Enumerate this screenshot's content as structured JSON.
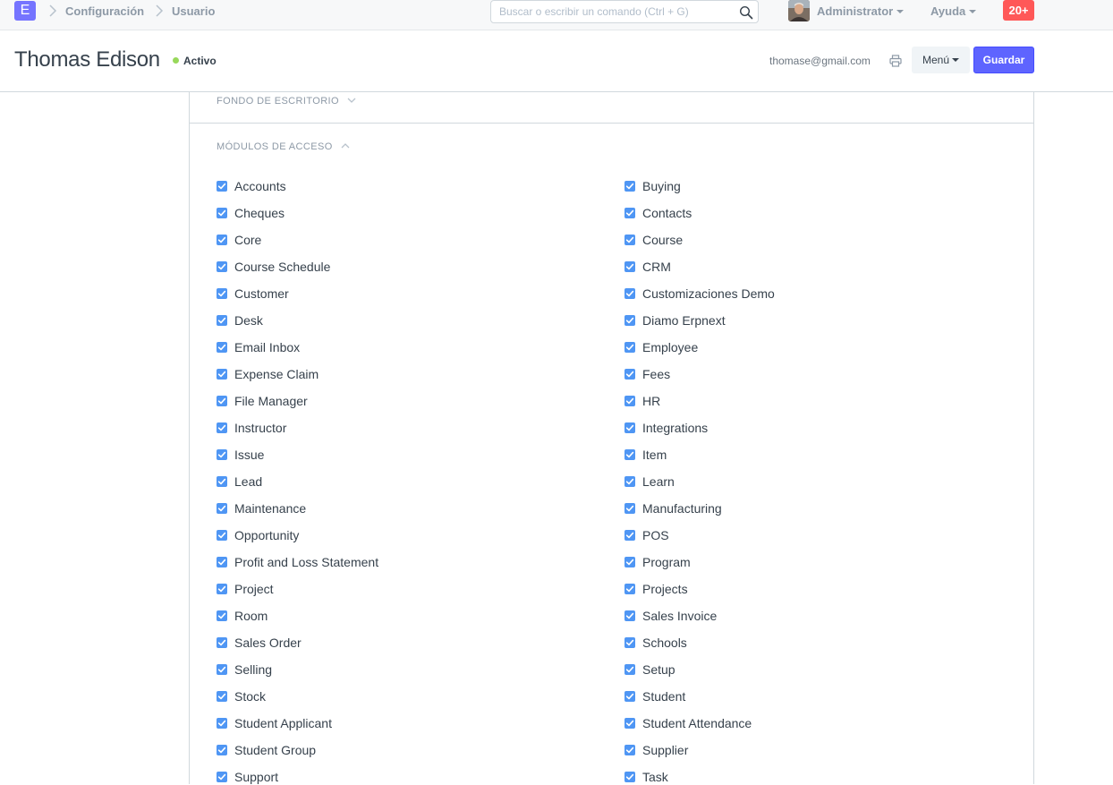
{
  "navbar": {
    "logo_letter": "E",
    "breadcrumbs": [
      "Configuración",
      "Usuario"
    ],
    "search_placeholder": "Buscar o escribir un comando (Ctrl + G)",
    "search_icon": "search-icon",
    "user_name": "Administrator",
    "help_label": "Ayuda",
    "notifications_badge": "20+"
  },
  "page_head": {
    "title": "Thomas Edison",
    "status": "Activo",
    "status_color": "#98d85b",
    "email": "thomase@gmail.com",
    "print_icon": "print-icon",
    "menu_label": "Menú",
    "save_label": "Guardar",
    "save_color": "#5e64ff"
  },
  "sections": {
    "desktop_background": {
      "title": "FONDO DE ESCRITORIO",
      "collapsed": true
    },
    "access_modules": {
      "title": "MÓDULOS DE ACCESO",
      "collapsed": false
    }
  },
  "modules": [
    {
      "label": "Accounts",
      "checked": true
    },
    {
      "label": "Buying",
      "checked": true
    },
    {
      "label": "Cheques",
      "checked": true
    },
    {
      "label": "Contacts",
      "checked": true
    },
    {
      "label": "Core",
      "checked": true
    },
    {
      "label": "Course",
      "checked": true
    },
    {
      "label": "Course Schedule",
      "checked": true
    },
    {
      "label": "CRM",
      "checked": true
    },
    {
      "label": "Customer",
      "checked": true
    },
    {
      "label": "Customizaciones Demo",
      "checked": true
    },
    {
      "label": "Desk",
      "checked": true
    },
    {
      "label": "Diamo Erpnext",
      "checked": true
    },
    {
      "label": "Email Inbox",
      "checked": true
    },
    {
      "label": "Employee",
      "checked": true
    },
    {
      "label": "Expense Claim",
      "checked": true
    },
    {
      "label": "Fees",
      "checked": true
    },
    {
      "label": "File Manager",
      "checked": true
    },
    {
      "label": "HR",
      "checked": true
    },
    {
      "label": "Instructor",
      "checked": true
    },
    {
      "label": "Integrations",
      "checked": true
    },
    {
      "label": "Issue",
      "checked": true
    },
    {
      "label": "Item",
      "checked": true
    },
    {
      "label": "Lead",
      "checked": true
    },
    {
      "label": "Learn",
      "checked": true
    },
    {
      "label": "Maintenance",
      "checked": true
    },
    {
      "label": "Manufacturing",
      "checked": true
    },
    {
      "label": "Opportunity",
      "checked": true
    },
    {
      "label": "POS",
      "checked": true
    },
    {
      "label": "Profit and Loss Statement",
      "checked": true
    },
    {
      "label": "Program",
      "checked": true
    },
    {
      "label": "Project",
      "checked": true
    },
    {
      "label": "Projects",
      "checked": true
    },
    {
      "label": "Room",
      "checked": true
    },
    {
      "label": "Sales Invoice",
      "checked": true
    },
    {
      "label": "Sales Order",
      "checked": true
    },
    {
      "label": "Schools",
      "checked": true
    },
    {
      "label": "Selling",
      "checked": true
    },
    {
      "label": "Setup",
      "checked": true
    },
    {
      "label": "Stock",
      "checked": true
    },
    {
      "label": "Student",
      "checked": true
    },
    {
      "label": "Student Applicant",
      "checked": true
    },
    {
      "label": "Student Attendance",
      "checked": true
    },
    {
      "label": "Student Group",
      "checked": true
    },
    {
      "label": "Supplier",
      "checked": true
    },
    {
      "label": "Support",
      "checked": true
    },
    {
      "label": "Task",
      "checked": true
    }
  ],
  "checkbox_color": "#4f96f4"
}
